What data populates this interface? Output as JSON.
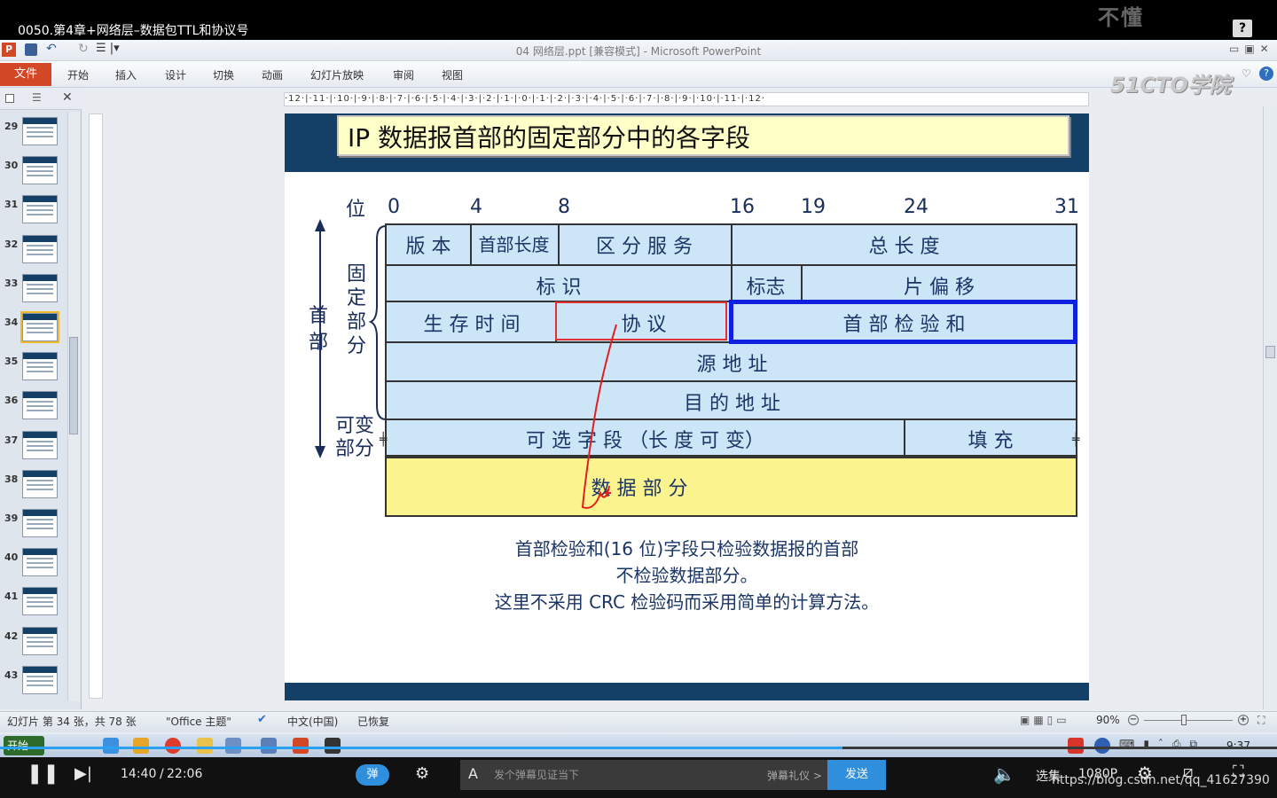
{
  "video": {
    "title": "0050.第4章+网络层–数据包TTL和协议号",
    "watermark": "不懂",
    "help": "?"
  },
  "ppt": {
    "window_title": "04 网络层.ppt [兼容模式] - Microsoft PowerPoint",
    "tabs": [
      "文件",
      "开始",
      "插入",
      "设计",
      "切换",
      "动画",
      "幻灯片放映",
      "审阅",
      "视图"
    ],
    "logo_watermark": "51CTO学院",
    "ruler_h": "·12·|·11·|·10·|·9·|·8·|·7·|·6·|·5·|·4·|·3·|·2·|·1·|·0·|·1·|·2·|·3·|·4·|·5·|·6·|·7·|·8·|·9·|·10·|·11·|·12·"
  },
  "thumbnails": [
    {
      "num": "29"
    },
    {
      "num": "30"
    },
    {
      "num": "31"
    },
    {
      "num": "32"
    },
    {
      "num": "33"
    },
    {
      "num": "34",
      "selected": true
    },
    {
      "num": "35"
    },
    {
      "num": "36"
    },
    {
      "num": "37"
    },
    {
      "num": "38"
    },
    {
      "num": "39"
    },
    {
      "num": "40"
    },
    {
      "num": "41"
    },
    {
      "num": "42"
    },
    {
      "num": "43"
    }
  ],
  "slide": {
    "title": "IP 数据报首部的固定部分中的各字段",
    "bit_label": "位",
    "bits": [
      "0",
      "4",
      "8",
      "16",
      "19",
      "24",
      "31"
    ],
    "side_header": "首部",
    "side_fixed": "固定部分",
    "side_variable": "可变部分",
    "cells": {
      "version": "版 本",
      "hlen": "首部长度",
      "ds": "区 分 服 务",
      "total_len": "总  长  度",
      "ident": "标    识",
      "flags": "标志",
      "frag": "片  偏  移",
      "ttl": "生 存 时 间",
      "proto": "协    议",
      "checksum": "首  部  检  验  和",
      "src": "源  地  址",
      "dst": "目  的  地  址",
      "options": "可  选  字  段  （长  度  可  变）",
      "padding": "填    充",
      "data": "数      据      部      分"
    },
    "caption_lines": [
      "首部检验和(16 位)字段只检验数据报的首部",
      "不检验数据部分。",
      "这里不采用 CRC 检验码而采用简单的计算方法。"
    ]
  },
  "statusbar": {
    "slide_info": "幻灯片 第 34 张，共 78 张",
    "theme": "\"Office 主题\"",
    "lang": "中文(中国)",
    "recovered": "已恢复",
    "zoom": "90%"
  },
  "taskbar": {
    "start": "开始",
    "time": "9:37"
  },
  "player": {
    "current_time": "14:40",
    "duration": "22:06",
    "danmu_toggle": "弹",
    "danmu_placeholder": "发个弹幕见证当下",
    "danmu_etiquette": "弹幕礼仪 >",
    "send": "发送",
    "select_episode": "选集",
    "quality": "1080P",
    "url_watermark": "https://blog.csdn.net/qq_41627390"
  }
}
